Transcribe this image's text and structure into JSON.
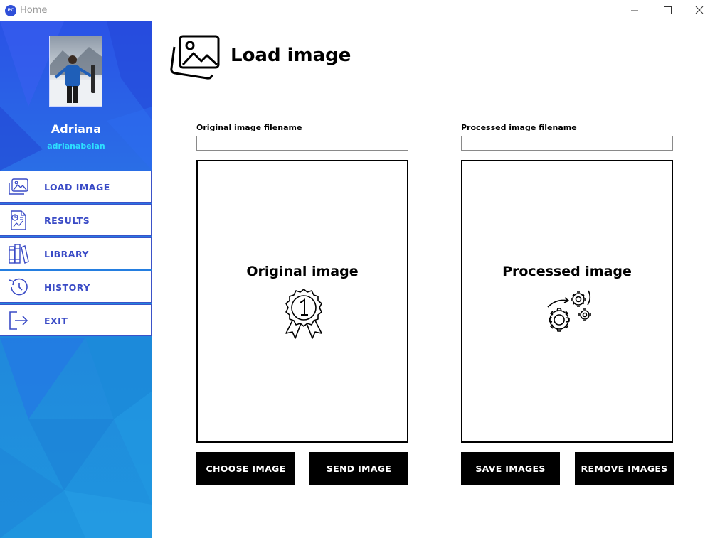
{
  "window": {
    "app_icon_text": "PC",
    "title": "Home"
  },
  "sidebar": {
    "user": {
      "name": "Adriana",
      "handle": "adrianabeian"
    },
    "items": [
      {
        "label": "LOAD IMAGE",
        "icon": "image-icon"
      },
      {
        "label": "RESULTS",
        "icon": "report-icon"
      },
      {
        "label": "LIBRARY",
        "icon": "books-icon"
      },
      {
        "label": "HISTORY",
        "icon": "history-icon"
      },
      {
        "label": "EXIT",
        "icon": "exit-icon"
      }
    ]
  },
  "main": {
    "title": "Load image",
    "original": {
      "field_label": "Original image filename",
      "field_value": "",
      "panel_title": "Original image",
      "icon": "award-ribbon-icon",
      "buttons": [
        "CHOOSE IMAGE",
        "SEND IMAGE"
      ]
    },
    "processed": {
      "field_label": "Processed image filename",
      "field_value": "",
      "panel_title": "Processed image",
      "icon": "gears-icon",
      "buttons": [
        "SAVE IMAGES",
        "REMOVE IMAGES"
      ]
    }
  },
  "colors": {
    "sidebar_top": "#2a52e6",
    "sidebar_bottom": "#1f95de",
    "menu_text": "#3a4bc6",
    "handle_text": "#2de0ff",
    "button_bg": "#000000"
  }
}
